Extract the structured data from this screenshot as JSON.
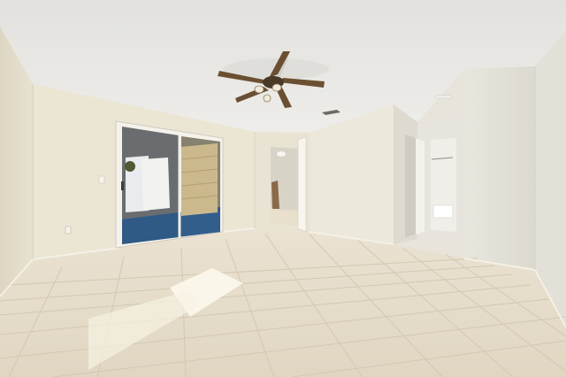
{
  "scene": {
    "kind": "photo",
    "subject": "empty room",
    "objects": [
      "ceiling-fan",
      "sliding-glass-door",
      "interior-doorway",
      "hallway",
      "tile-floor",
      "air-vent",
      "wall-outlet"
    ]
  },
  "palette": {
    "ceiling": "#e9e8e4",
    "wall_left": "#e6e0cf",
    "wall_back": "#ebe5d6",
    "wall_right": "#eceae1",
    "floor": "#e2d9c6",
    "grout": "#cfc5b0",
    "fan_blade": "#6b4f32",
    "carpet": "#2f5a86",
    "sunlight": "#fbf7ea"
  }
}
